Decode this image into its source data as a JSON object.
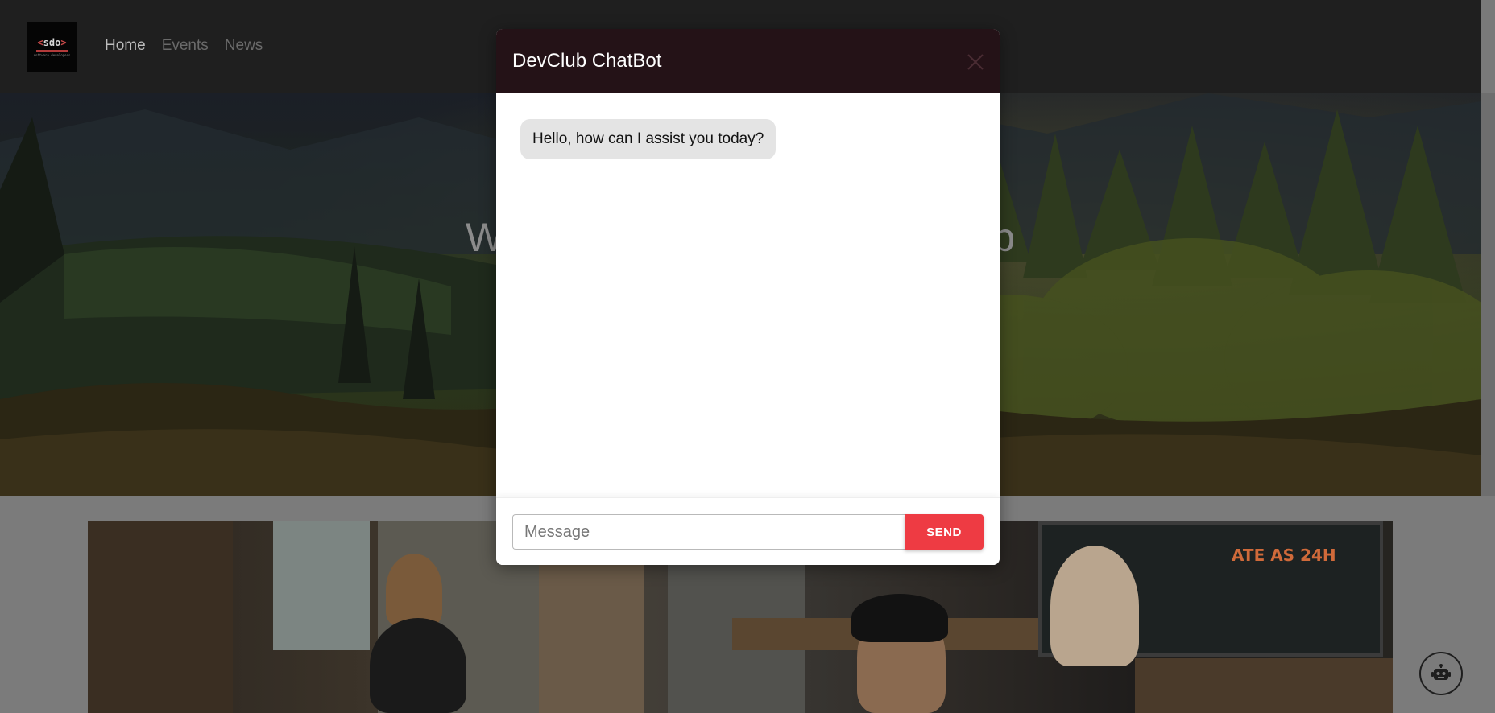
{
  "nav": {
    "logo": {
      "main_text": "sdo",
      "sub_text": "software developers"
    },
    "links": [
      {
        "label": "Home",
        "active": true
      },
      {
        "label": "Events",
        "active": false
      },
      {
        "label": "News",
        "active": false
      }
    ]
  },
  "hero": {
    "title_visible_left": "W",
    "title_visible_right": "b"
  },
  "content": {
    "board_text_1": "ATE AS 24H"
  },
  "chatbot": {
    "title": "DevClub ChatBot",
    "close_icon": "close-icon",
    "messages": [
      {
        "sender": "bot",
        "text": "Hello, how can I assist you today?"
      }
    ],
    "input": {
      "placeholder": "Message",
      "value": ""
    },
    "send_label": "SEND",
    "accent_color": "#ee3b43",
    "header_color": "#241217"
  },
  "fab": {
    "icon": "robot-icon"
  }
}
